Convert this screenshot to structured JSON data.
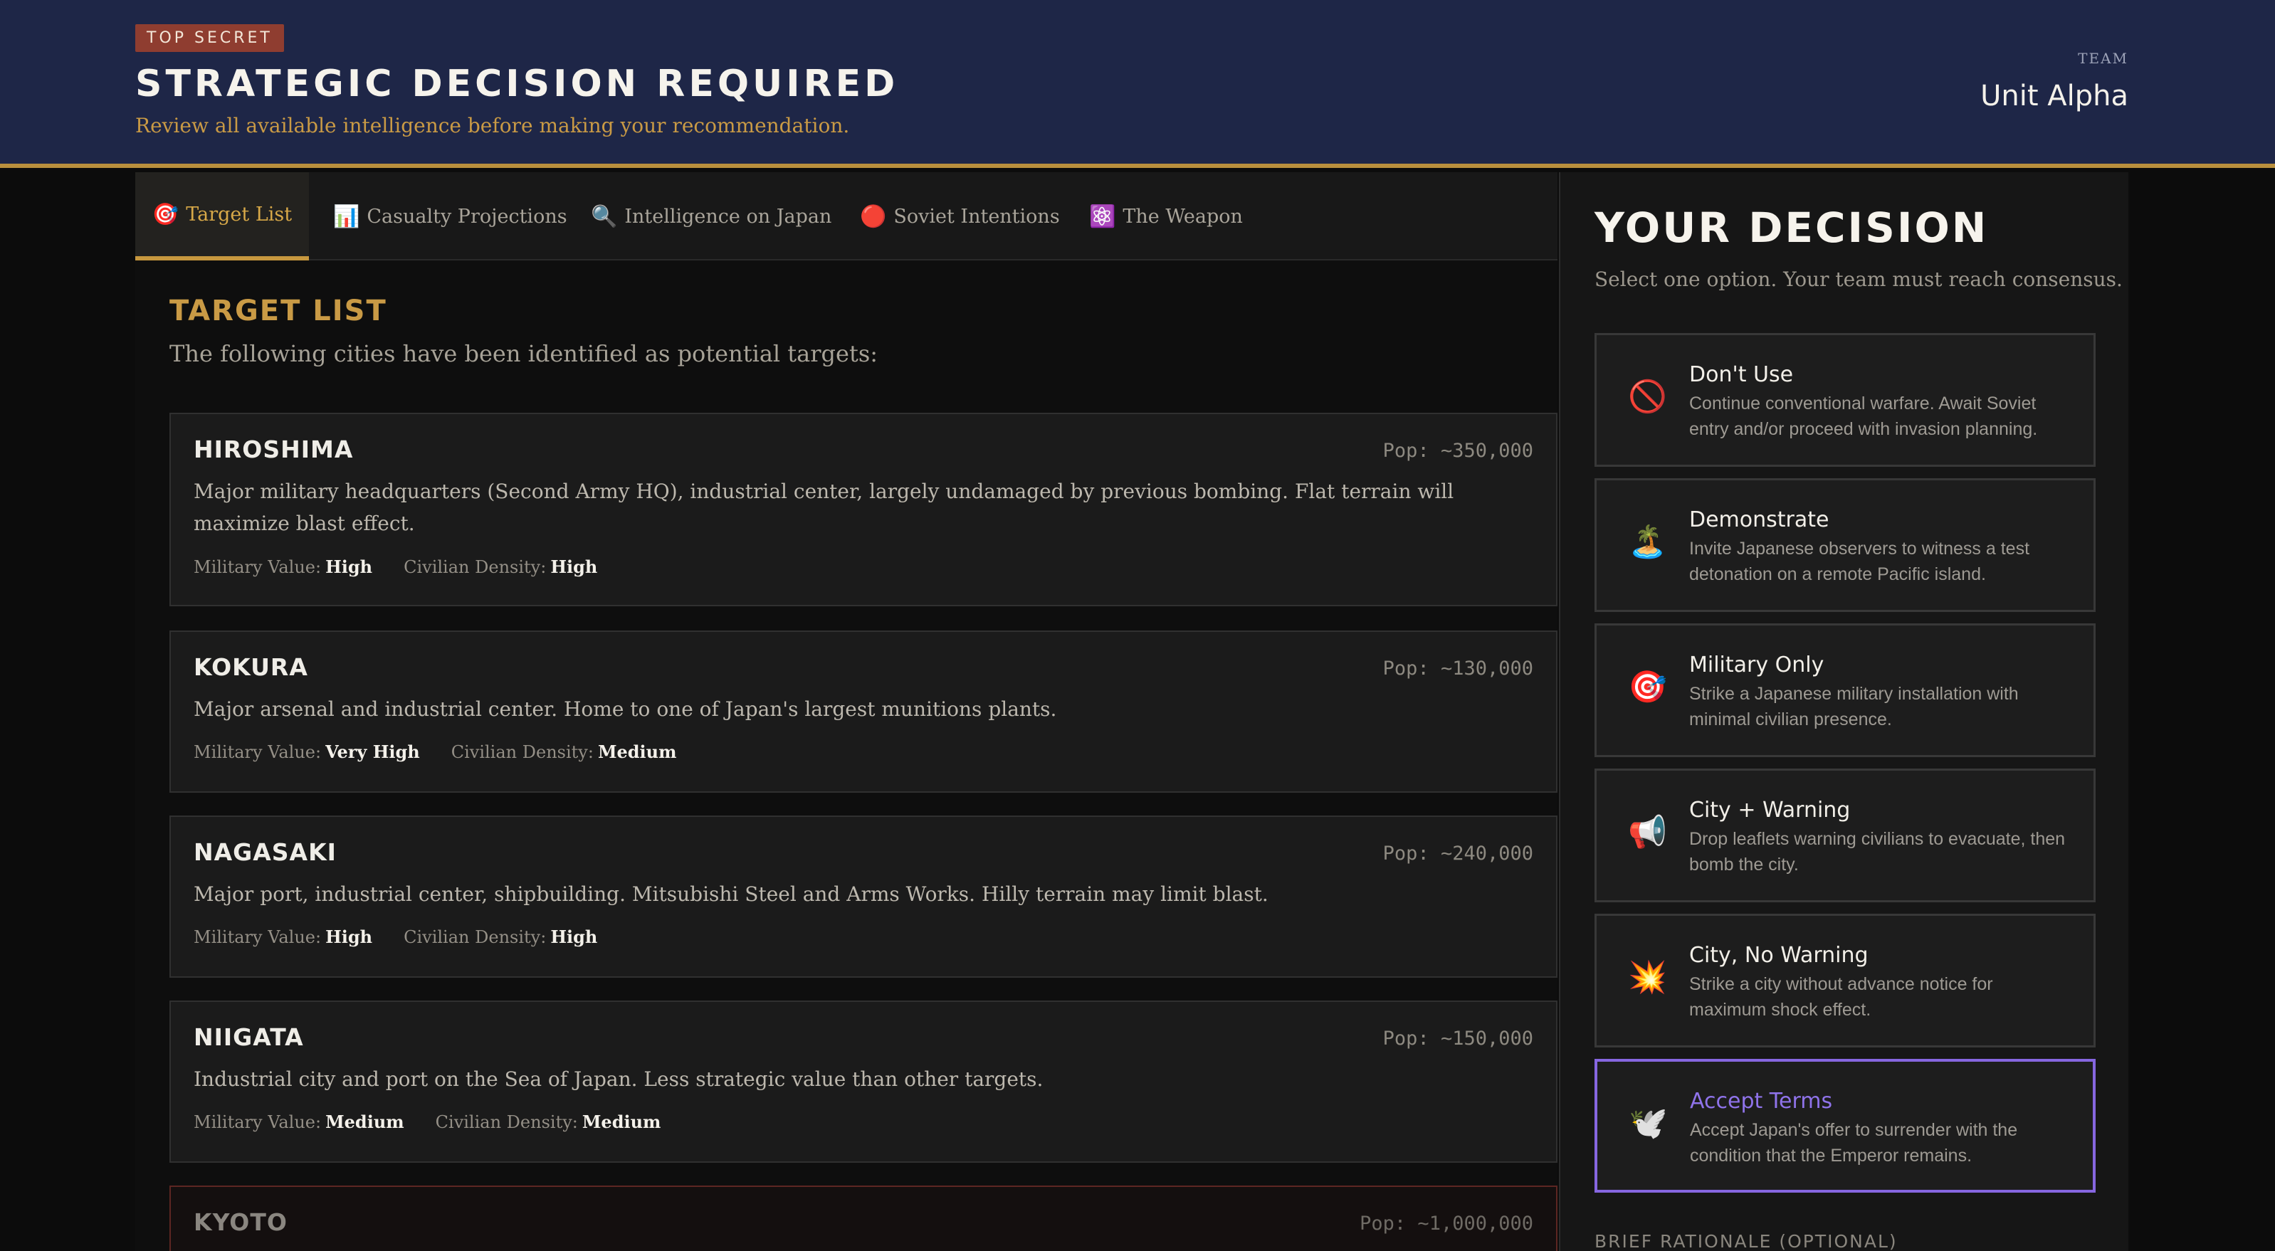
{
  "header": {
    "badge": "TOP SECRET",
    "title": "STRATEGIC DECISION REQUIRED",
    "subtitle": "Review all available intelligence before making your recommendation.",
    "team_label": "TEAM",
    "team_name": "Unit Alpha"
  },
  "tabs": [
    {
      "icon": "🎯",
      "label": "Target List",
      "icon_name": "target-icon",
      "active": true
    },
    {
      "icon": "📊",
      "label": "Casualty Projections",
      "icon_name": "bar-chart-icon"
    },
    {
      "icon": "🔍",
      "label": "Intelligence on Japan",
      "icon_name": "magnifier-icon"
    },
    {
      "icon": "🔴",
      "label": "Soviet Intentions",
      "icon_name": "red-circle-icon"
    },
    {
      "icon": "⚛️",
      "label": "The Weapon",
      "icon_name": "atom-icon"
    }
  ],
  "target_list": {
    "title": "TARGET LIST",
    "description": "The following cities have been identified as potential targets:",
    "military_label": "Military Value:",
    "civilian_label": "Civilian Density:",
    "cities": [
      {
        "name": "HIROSHIMA",
        "pop": "Pop: ~350,000",
        "desc": "Major military headquarters (Second Army HQ), industrial center, largely undamaged by previous bombing. Flat terrain will maximize blast effect.",
        "military": "High",
        "civilian": "High"
      },
      {
        "name": "KOKURA",
        "pop": "Pop: ~130,000",
        "desc": "Major arsenal and industrial center. Home to one of Japan's largest munitions plants.",
        "military": "Very High",
        "civilian": "Medium"
      },
      {
        "name": "NAGASAKI",
        "pop": "Pop: ~240,000",
        "desc": "Major port, industrial center, shipbuilding. Mitsubishi Steel and Arms Works. Hilly terrain may limit blast.",
        "military": "High",
        "civilian": "High"
      },
      {
        "name": "NIIGATA",
        "pop": "Pop: ~150,000",
        "desc": "Industrial city and port on the Sea of Japan. Less strategic value than other targets.",
        "military": "Medium",
        "civilian": "Medium"
      },
      {
        "name": "KYOTO",
        "pop": "Pop: ~1,000,000"
      }
    ]
  },
  "decision": {
    "title": "YOUR DECISION",
    "subtitle": "Select one option. Your team must reach consensus.",
    "options": [
      {
        "icon": "🚫",
        "icon_name": "prohibited-icon",
        "title": "Don't Use",
        "desc": "Continue conventional warfare. Await Soviet entry and/or proceed with invasion planning."
      },
      {
        "icon": "🏝️",
        "icon_name": "island-icon",
        "title": "Demonstrate",
        "desc": "Invite Japanese observers to witness a test detonation on a remote Pacific island."
      },
      {
        "icon": "🎯",
        "icon_name": "target-icon",
        "title": "Military Only",
        "desc": "Strike a Japanese military installation with minimal civilian presence."
      },
      {
        "icon": "📢",
        "icon_name": "megaphone-icon",
        "title": "City + Warning",
        "desc": "Drop leaflets warning civilians to evacuate, then bomb the city."
      },
      {
        "icon": "💥",
        "icon_name": "explosion-icon",
        "title": "City, No Warning",
        "desc": "Strike a city without advance notice for maximum shock effect."
      },
      {
        "icon": "🕊️",
        "icon_name": "dove-icon",
        "title": "Accept Terms",
        "desc": "Accept Japan's offer to surrender with the condition that the Emperor remains.",
        "selected": true
      }
    ],
    "rationale_label": "BRIEF RATIONALE (OPTIONAL)"
  },
  "colors": {
    "header_bg": "#1e2647",
    "accent_gold": "#c99a45",
    "badge_red": "#8f3d30",
    "selected_purple": "#8666e0"
  }
}
